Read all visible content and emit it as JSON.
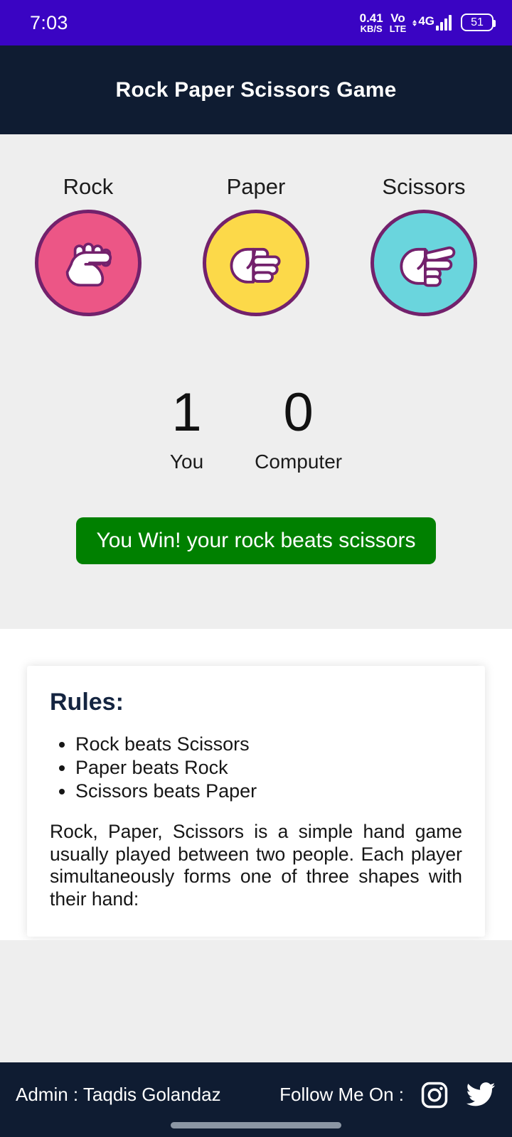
{
  "status_bar": {
    "time": "7:03",
    "network_speed_value": "0.41",
    "network_speed_unit": "KB/S",
    "volte_line1": "Vo",
    "volte_line2": "LTE",
    "network_type": "4G",
    "battery_percent": "51",
    "background_color": "#3a04c3"
  },
  "header": {
    "title": "Rock Paper Scissors Game",
    "background_color": "#0f1c32"
  },
  "game": {
    "choices": [
      {
        "label": "Rock",
        "icon": "fist-icon",
        "circle_color": "#ec5686",
        "border_color": "#73216c"
      },
      {
        "label": "Paper",
        "icon": "flat-hand-icon",
        "circle_color": "#fcd949",
        "border_color": "#73216c"
      },
      {
        "label": "Scissors",
        "icon": "two-finger-hand-icon",
        "circle_color": "#6ad5dd",
        "border_color": "#73216c"
      }
    ],
    "score": {
      "player_value": "1",
      "player_label": "You",
      "computer_value": "0",
      "computer_label": "Computer"
    },
    "result": {
      "text": "You Win! your rock beats scissors",
      "background_color": "#008000",
      "text_color": "#ffffff"
    },
    "background_color": "#eeeeee"
  },
  "rules": {
    "title": "Rules:",
    "title_color": "#142440",
    "items": [
      "Rock beats Scissors",
      "Paper beats Rock",
      "Scissors beats Paper"
    ],
    "paragraph": "Rock, Paper, Scissors is a simple hand game usually played between two people. Each player simultaneously forms one of three shapes with their hand:"
  },
  "footer": {
    "admin_text": "Admin :  Taqdis Golandaz",
    "follow_text": "Follow Me On :",
    "social": [
      {
        "name": "instagram-icon"
      },
      {
        "name": "twitter-icon"
      }
    ],
    "background_color": "#0f1c32"
  }
}
